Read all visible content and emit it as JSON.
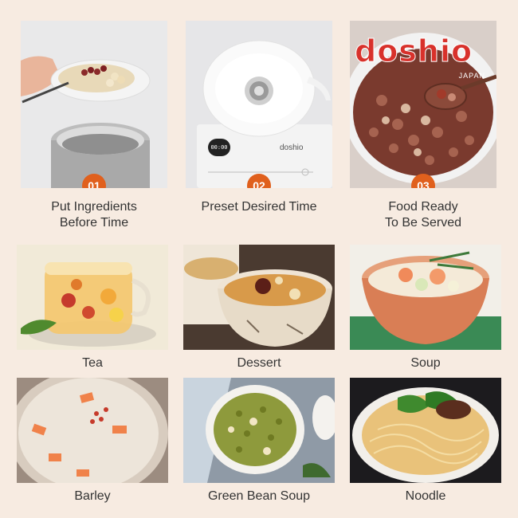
{
  "brand": {
    "name": "doshio",
    "sub": "JAPAN"
  },
  "steps": [
    {
      "number": "01",
      "label_line1": "Put Ingredients",
      "label_line2": "Before Time"
    },
    {
      "number": "02",
      "label_line1": "Preset Desired Time",
      "label_line2": ""
    },
    {
      "number": "03",
      "label_line1": "Food Ready",
      "label_line2": "To Be Served"
    }
  ],
  "cooker_display": "00:00",
  "cooker_brand": "doshio",
  "dishes": [
    {
      "label": "Tea"
    },
    {
      "label": "Dessert"
    },
    {
      "label": "Soup"
    },
    {
      "label": "Barley"
    },
    {
      "label": "Green Bean Soup"
    },
    {
      "label": "Noodle"
    }
  ],
  "colors": {
    "accent": "#e0601d",
    "background": "#f7ebe1",
    "brand_red": "#d8312b"
  }
}
